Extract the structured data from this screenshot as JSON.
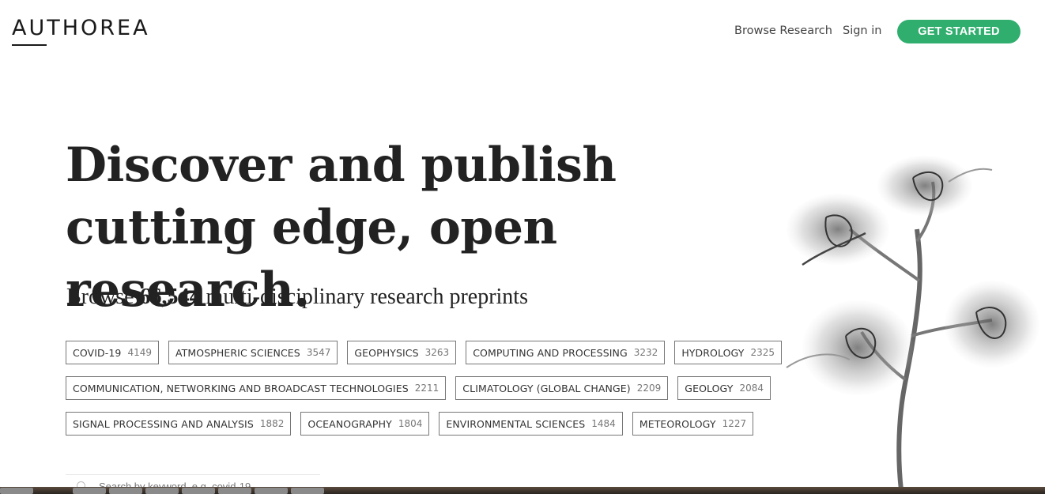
{
  "brand": {
    "logo_text": "AUTHOREA"
  },
  "nav": {
    "browse_label": "Browse Research",
    "signin_label": "Sign in",
    "cta_label": "GET STARTED"
  },
  "hero": {
    "title": "Discover and publish cutting edge, open research.",
    "browse_prefix": "Browse",
    "browse_count": "66,544",
    "browse_suffix": "multi-disciplinary research preprints"
  },
  "tags": {
    "row1": [
      {
        "name": "COVID-19",
        "count": "4149"
      },
      {
        "name": "ATMOSPHERIC SCIENCES",
        "count": "3547"
      },
      {
        "name": "GEOPHYSICS",
        "count": "3263"
      },
      {
        "name": "COMPUTING AND PROCESSING",
        "count": "3232"
      },
      {
        "name": "HYDROLOGY",
        "count": "2325"
      }
    ],
    "row2": [
      {
        "name": "COMMUNICATION, NETWORKING AND BROADCAST TECHNOLOGIES",
        "count": "2211"
      },
      {
        "name": "CLIMATOLOGY (GLOBAL CHANGE)",
        "count": "2209"
      },
      {
        "name": "GEOLOGY",
        "count": "2084"
      }
    ],
    "row3": [
      {
        "name": "SIGNAL PROCESSING AND ANALYSIS",
        "count": "1882"
      },
      {
        "name": "OCEANOGRAPHY",
        "count": "1804"
      },
      {
        "name": "ENVIRONMENTAL SCIENCES",
        "count": "1484"
      },
      {
        "name": "METEOROLOGY",
        "count": "1227"
      }
    ]
  },
  "search": {
    "placeholder": "Search by keyword, e.g. covid-19"
  },
  "colors": {
    "accent": "#2fae6e",
    "text": "#222222",
    "tag_border": "#777777"
  },
  "icons": {
    "search": "search-icon",
    "hero_image": "orchid-xray-illustration"
  }
}
